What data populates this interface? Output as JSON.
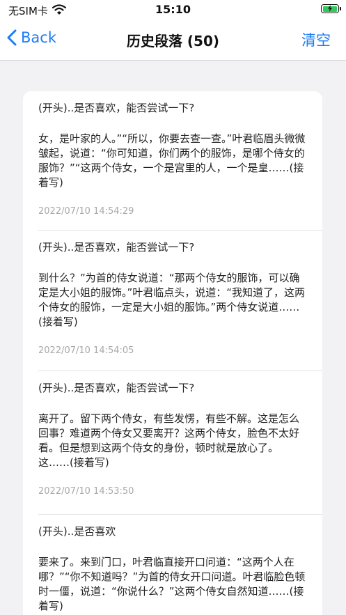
{
  "status_bar": {
    "carrier": "无SIM卡",
    "time": "15:10"
  },
  "nav": {
    "back_label": "Back",
    "title": "历史段落 (50)",
    "clear_label": "清空"
  },
  "history": [
    {
      "head": "(开头)..是否喜欢，能否尝试一下?",
      "body": "女，是叶家的人。”“所以，你要去查一查。”叶君临眉头微微皱起，说道：“你可知道，你们两个的服饰，是哪个侍女的服饰？”“这两个侍女，一个是宫里的人，一个是皇……(接着写)",
      "time": "2022/07/10 14:54:29"
    },
    {
      "head": "(开头)..是否喜欢，能否尝试一下?",
      "body": "到什么？”为首的侍女说道：“那两个侍女的服饰，可以确定是大小姐的服饰。”叶君临点头，说道：“我知道了，这两个侍女的服饰，一定是大小姐的服饰。”两个侍女说道……(接着写)",
      "time": "2022/07/10 14:54:05"
    },
    {
      "head": "(开头)..是否喜欢，能否尝试一下?",
      "body": "离开了。留下两个侍女，有些发愣，有些不解。这是怎么回事？难道两个侍女又要离开？这两个侍女，脸色不太好看。但是想到这两个侍女的身份，顿时就是放心了。这……(接着写)",
      "time": "2022/07/10 14:53:50"
    },
    {
      "head": "(开头)..是否喜欢",
      "body": "要来了。来到门口，叶君临直接开口问道：“这两个人在哪？”“你不知道吗？”为首的侍女开口问道。叶君临脸色顿时一僵，说道：“你说什么？”这两个侍女自然知道……(接着写)",
      "time": ""
    }
  ]
}
